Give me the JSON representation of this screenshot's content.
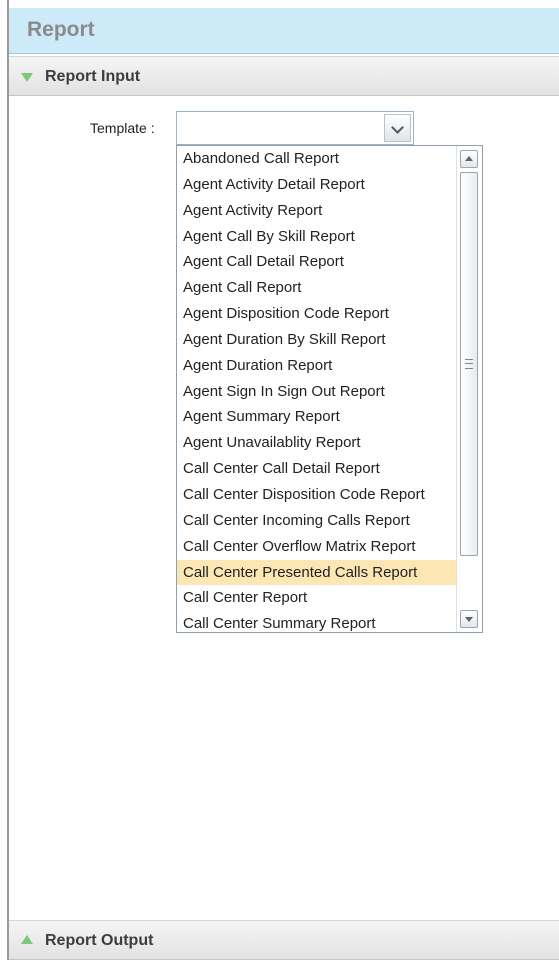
{
  "header": {
    "title": "Report"
  },
  "report_input": {
    "label": "Report Input"
  },
  "template": {
    "label": "Template :",
    "value": "",
    "options": [
      "Abandoned Call Report",
      "Agent Activity Detail Report",
      "Agent Activity Report",
      "Agent Call By Skill Report",
      "Agent Call Detail Report",
      "Agent Call Report",
      "Agent Disposition Code Report",
      "Agent Duration By Skill Report",
      "Agent Duration Report",
      "Agent Sign In Sign Out Report",
      "Agent Summary Report",
      "Agent Unavailablity Report",
      "Call Center Call Detail Report",
      "Call Center Disposition Code Report",
      "Call Center Incoming Calls Report",
      "Call Center Overflow Matrix Report",
      "Call Center Presented Calls Report",
      "Call Center Report",
      "Call Center Summary Report"
    ],
    "highlighted": "Call Center Presented Calls Report"
  },
  "report_output": {
    "label": "Report Output"
  },
  "colors": {
    "header_bg": "#cdeaf8",
    "accent_green": "#7cc87a",
    "highlight": "#fbe6b4"
  },
  "icons": {
    "expand": "triangle-down-icon",
    "collapse": "triangle-up-icon",
    "combo": "chevron-down-icon"
  }
}
